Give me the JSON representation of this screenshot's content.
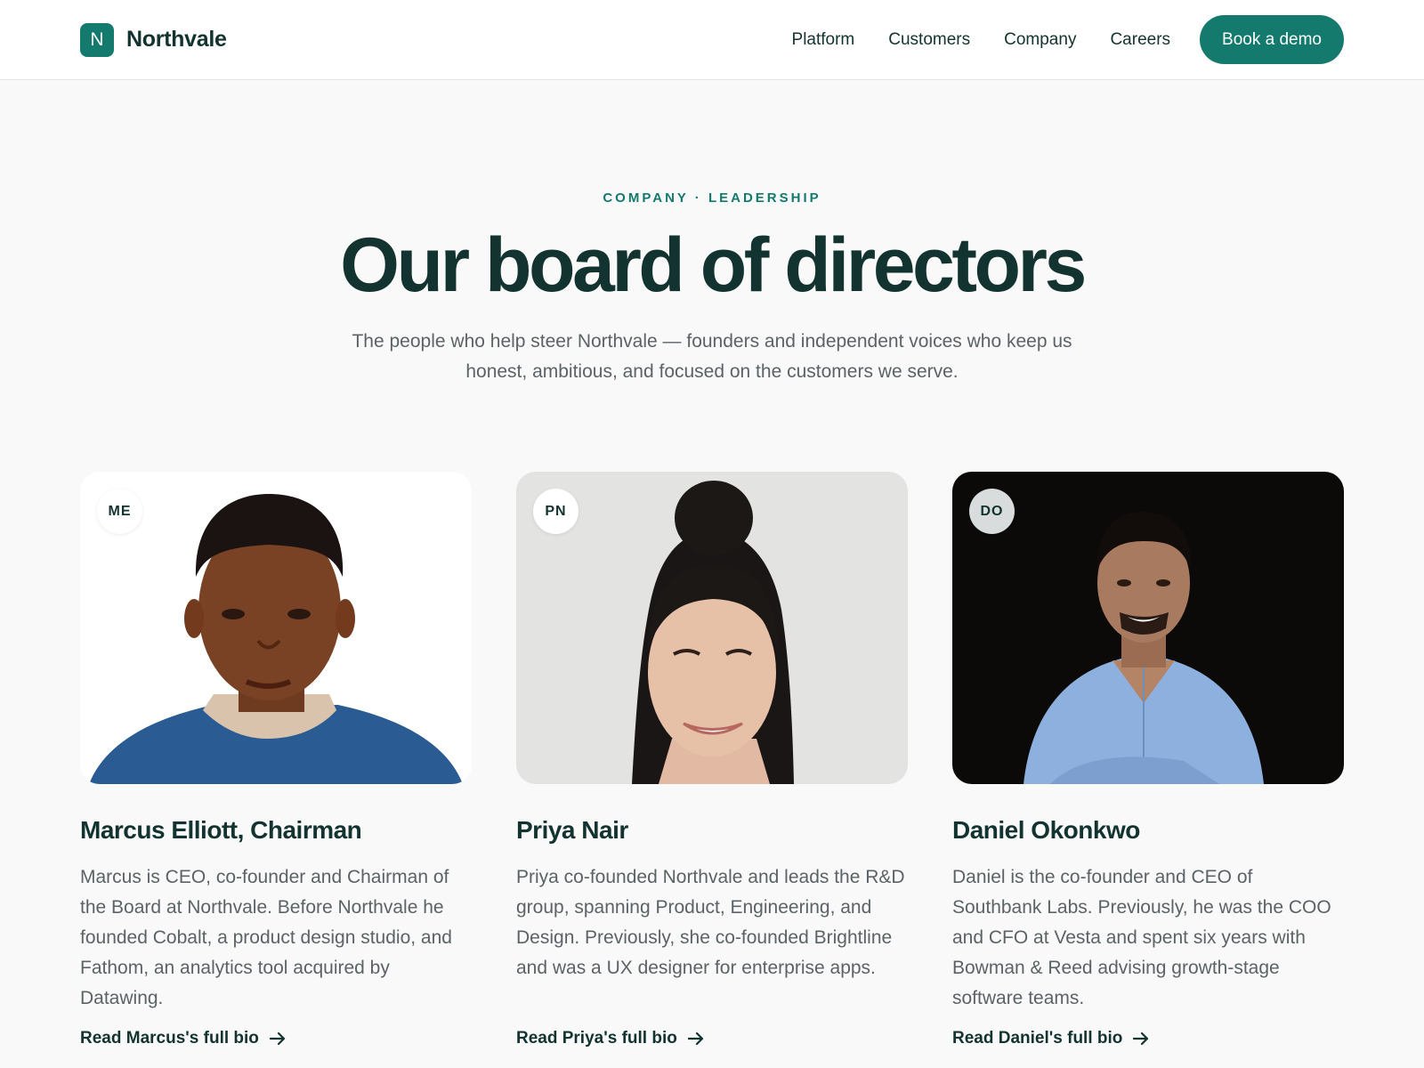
{
  "brand": {
    "logo_letter": "N",
    "name": "Northvale",
    "accent": "#137a6d",
    "ink": "#12332f"
  },
  "nav": {
    "items": [
      {
        "label": "Platform"
      },
      {
        "label": "Customers"
      },
      {
        "label": "Company"
      },
      {
        "label": "Careers"
      }
    ],
    "cta_label": "Book a demo"
  },
  "hero": {
    "eyebrow": "COMPANY · LEADERSHIP",
    "title": "Our board of directors",
    "subtitle": "The people who help steer Northvale — founders and independent voices who keep us honest, ambitious, and focused on the customers we serve."
  },
  "members": [
    {
      "initials": "ME",
      "name": "Marcus Elliott, Chairman",
      "bio": "Marcus is CEO, co-founder and Chairman of the Board at Northvale. Before Northvale he founded Cobalt, a product design studio, and Fathom, an analytics tool acquired by Datawing.",
      "link_label": "Read Marcus's full bio",
      "photo_background": "#ffffff"
    },
    {
      "initials": "PN",
      "name": "Priya Nair",
      "bio": "Priya co-founded Northvale and leads the R&D group, spanning Product, Engineering, and Design. Previously, she co-founded Brightline and was a UX designer for enterprise apps.",
      "link_label": "Read Priya's full bio",
      "photo_background": "#e3e3e2"
    },
    {
      "initials": "DO",
      "name": "Daniel Okonkwo",
      "bio": "Daniel is the co-founder and CEO of Southbank Labs. Previously, he was the COO and CFO at Vesta and spent six years with Bowman & Reed advising growth-stage software teams.",
      "link_label": "Read Daniel's full bio",
      "photo_background": "#0b0a09"
    }
  ]
}
